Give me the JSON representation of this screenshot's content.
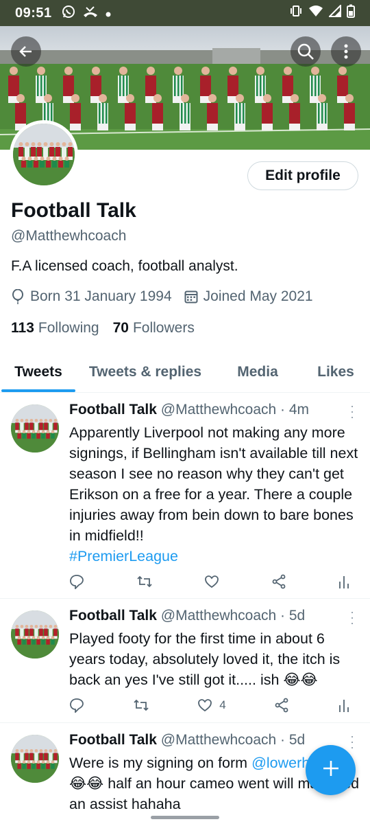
{
  "status_bar": {
    "time": "09:51",
    "left_icons": [
      "whatsapp-icon",
      "missed-call-icon",
      "dot-icon"
    ],
    "right_icons": [
      "vibrate-icon",
      "wifi-icon",
      "signal-icon",
      "battery-icon"
    ]
  },
  "header": {
    "back_icon": "back-arrow-icon",
    "search_icon": "search-icon",
    "more_icon": "more-vertical-icon"
  },
  "profile": {
    "name": "Football Talk",
    "handle": "@Matthewhcoach",
    "bio": "F.A licensed coach, football analyst.",
    "born": "Born 31 January 1994",
    "joined": "Joined May 2021",
    "following_count": "113",
    "following_label": "Following",
    "followers_count": "70",
    "followers_label": "Followers",
    "edit_label": "Edit profile"
  },
  "tabs": [
    {
      "label": "Tweets",
      "active": true
    },
    {
      "label": "Tweets & replies",
      "active": false
    },
    {
      "label": "Media",
      "active": false
    },
    {
      "label": "Likes",
      "active": false
    }
  ],
  "tweets": [
    {
      "name": "Football Talk",
      "handle_time": "@Matthewhcoach · 4m",
      "text": "Apparently Liverpool not making any more signings, if Bellingham isn't available till next season I see no reason why they can't get Erikson on a free for a year. There a couple injuries away from bein down to bare bones in midfield!!",
      "hashtag": "#PremierLeague",
      "likes": ""
    },
    {
      "name": "Football Talk",
      "handle_time": "@Matthewhcoach · 5d",
      "text": "Played footy for the first time in about 6 years today, absolutely loved it, the itch is back an yes I've still got it..... ish 😂😂",
      "hashtag": "",
      "likes": "4"
    },
    {
      "name": "Football Talk",
      "handle_time": "@Matthewhcoach · 5d",
      "text": "Were is my signing on form ",
      "mention": "@lowerh",
      "text2": "😂😂 half an hour cameo went will managed an assist hahaha",
      "hashtag": "",
      "likes": ""
    }
  ],
  "fab_icon": "compose-plus-icon",
  "colors": {
    "accent": "#1d9bf0",
    "text_primary": "#0f1419",
    "text_secondary": "#536471",
    "status_bar": "#3f4a36"
  }
}
